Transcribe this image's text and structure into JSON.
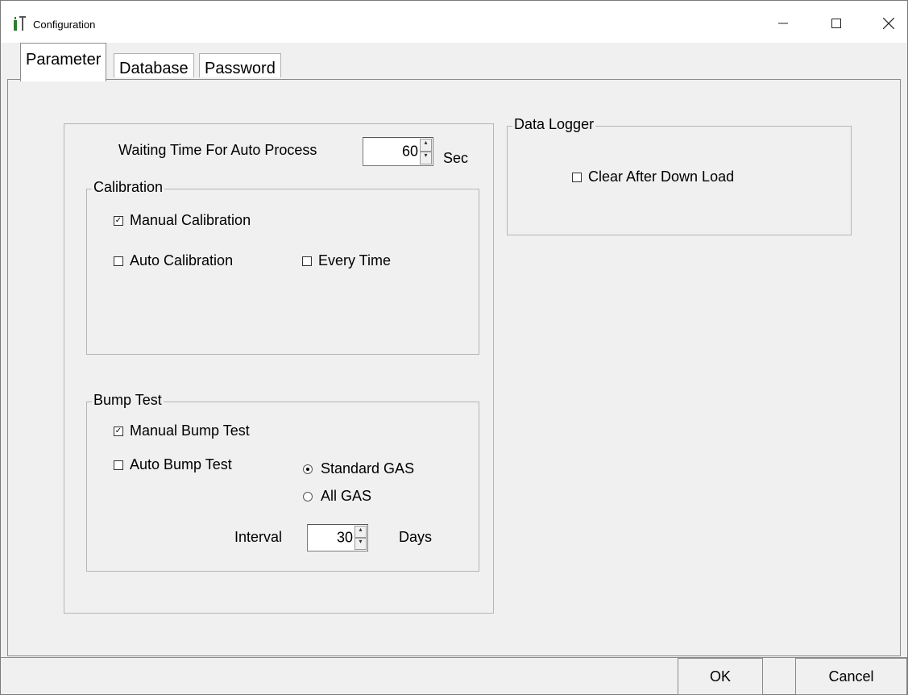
{
  "window": {
    "title": "Configuration",
    "app_icon": "gas-detector-icon"
  },
  "controls": {
    "minimize": "minimize-icon",
    "maximize": "maximize-icon",
    "close": "close-icon"
  },
  "tabs": [
    {
      "label": "Parameter",
      "active": true
    },
    {
      "label": "Database",
      "active": false
    },
    {
      "label": "Password",
      "active": false
    }
  ],
  "parameter": {
    "waiting_label": "Waiting Time For Auto Process",
    "waiting_value": "60",
    "waiting_unit": "Sec",
    "calibration": {
      "title": "Calibration",
      "manual": {
        "label": "Manual Calibration",
        "checked": true
      },
      "auto": {
        "label": "Auto Calibration",
        "checked": false
      },
      "every_time": {
        "label": "Every Time",
        "checked": false
      }
    },
    "bump": {
      "title": "Bump Test",
      "manual": {
        "label": "Manual Bump Test",
        "checked": true
      },
      "auto": {
        "label": "Auto Bump Test",
        "checked": false
      },
      "standard_gas": {
        "label": "Standard GAS",
        "selected": true
      },
      "all_gas": {
        "label": "All GAS",
        "selected": false
      },
      "interval_label": "Interval",
      "interval_value": "30",
      "interval_unit": "Days"
    }
  },
  "data_logger": {
    "title": "Data Logger",
    "clear": {
      "label": "Clear After Down Load",
      "checked": false
    }
  },
  "footer": {
    "ok": "OK",
    "cancel": "Cancel"
  }
}
